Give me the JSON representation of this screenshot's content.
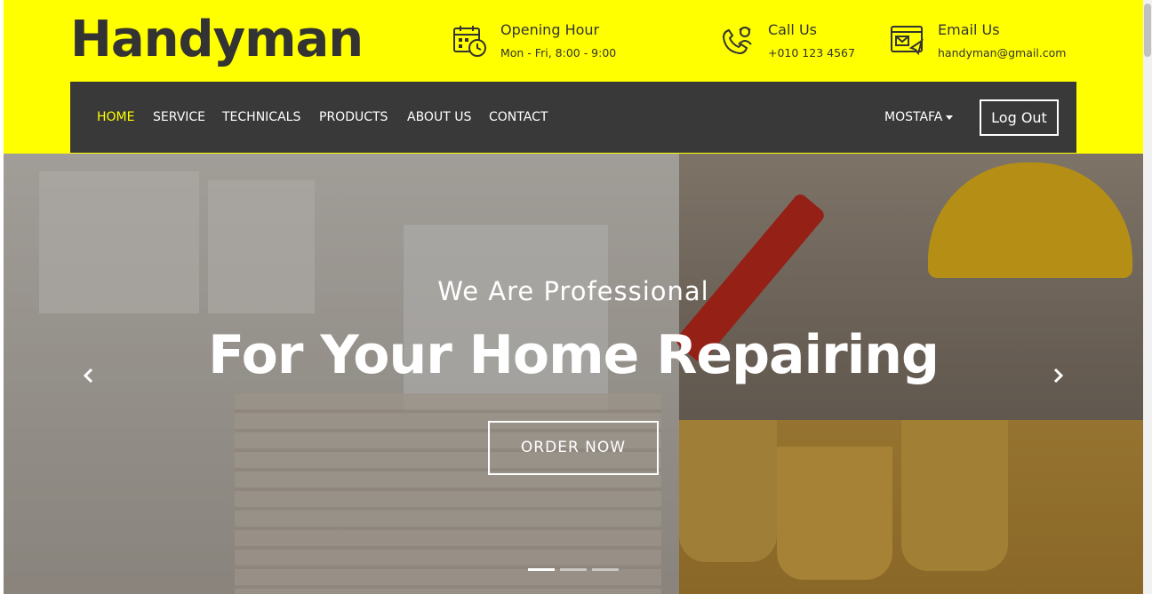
{
  "brand": {
    "logo": "Handyman"
  },
  "contact_info": {
    "opening": {
      "title": "Opening Hour",
      "detail": "Mon - Fri, 8:00 - 9:00",
      "icon": "calendar-clock-icon"
    },
    "call": {
      "title": "Call Us",
      "detail": "+010 123 4567",
      "icon": "phone-worker-icon"
    },
    "email": {
      "title": "Email Us",
      "detail": "handyman@gmail.com",
      "icon": "email-icon"
    }
  },
  "nav": {
    "items": [
      "HOME",
      "SERVICE",
      "TECHNICALS",
      "PRODUCTS",
      "ABOUT US",
      "CONTACT"
    ],
    "active": "HOME",
    "user": "MOSTAFA",
    "logout": "Log Out"
  },
  "hero": {
    "subtitle": "We Are Professional",
    "title": "For Your Home Repairing",
    "cta": "ORDER NOW",
    "slides": 3,
    "active_slide": 1
  },
  "colors": {
    "header_bg": "#ffff00",
    "nav_bg": "#393939",
    "active_nav": "#ffff00",
    "text_dark": "#333333"
  }
}
